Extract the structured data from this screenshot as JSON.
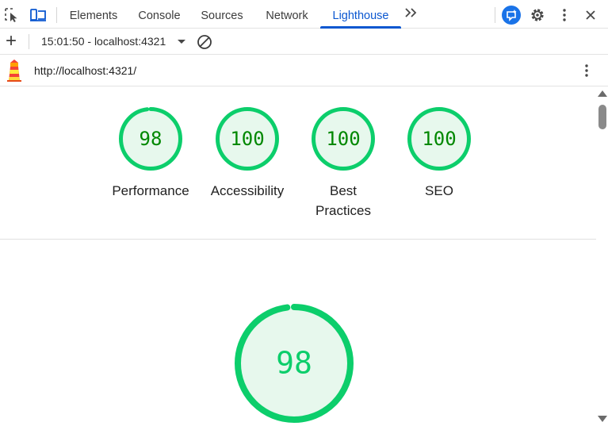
{
  "tabbar": {
    "tabs": [
      {
        "label": "Elements",
        "active": false
      },
      {
        "label": "Console",
        "active": false
      },
      {
        "label": "Sources",
        "active": false
      },
      {
        "label": "Network",
        "active": false
      },
      {
        "label": "Lighthouse",
        "active": true
      }
    ],
    "more_tabs_glyph": "»",
    "icons": [
      "inspect-element-icon",
      "device-toolbar-icon",
      "ai-assistance-icon",
      "settings-gear-icon",
      "more-vertical-icon",
      "close-icon"
    ],
    "accent_color": "#0b57d0"
  },
  "toolbar": {
    "add_glyph": "+",
    "report_selector": "15:01:50 - localhost:4321",
    "icons": [
      "add-icon",
      "dropdown-caret-icon",
      "clear-icon"
    ]
  },
  "urlbar": {
    "url": "http://localhost:4321/",
    "icons": [
      "lighthouse-logo-icon",
      "more-vertical-icon"
    ]
  },
  "scores": [
    {
      "label_lines": [
        "Performance"
      ],
      "score": "98",
      "progress": 0.98
    },
    {
      "label_lines": [
        "Accessibility"
      ],
      "score": "100",
      "progress": 1.0
    },
    {
      "label_lines": [
        "Best",
        "Practices"
      ],
      "score": "100",
      "progress": 1.0
    },
    {
      "label_lines": [
        "SEO"
      ],
      "score": "100",
      "progress": 1.0
    }
  ],
  "main_gauge": {
    "score": "98",
    "progress": 0.98
  },
  "colors": {
    "pass": "#0cce6b",
    "pass_fill": "#e7f8ed",
    "pass_text": "#008800"
  }
}
